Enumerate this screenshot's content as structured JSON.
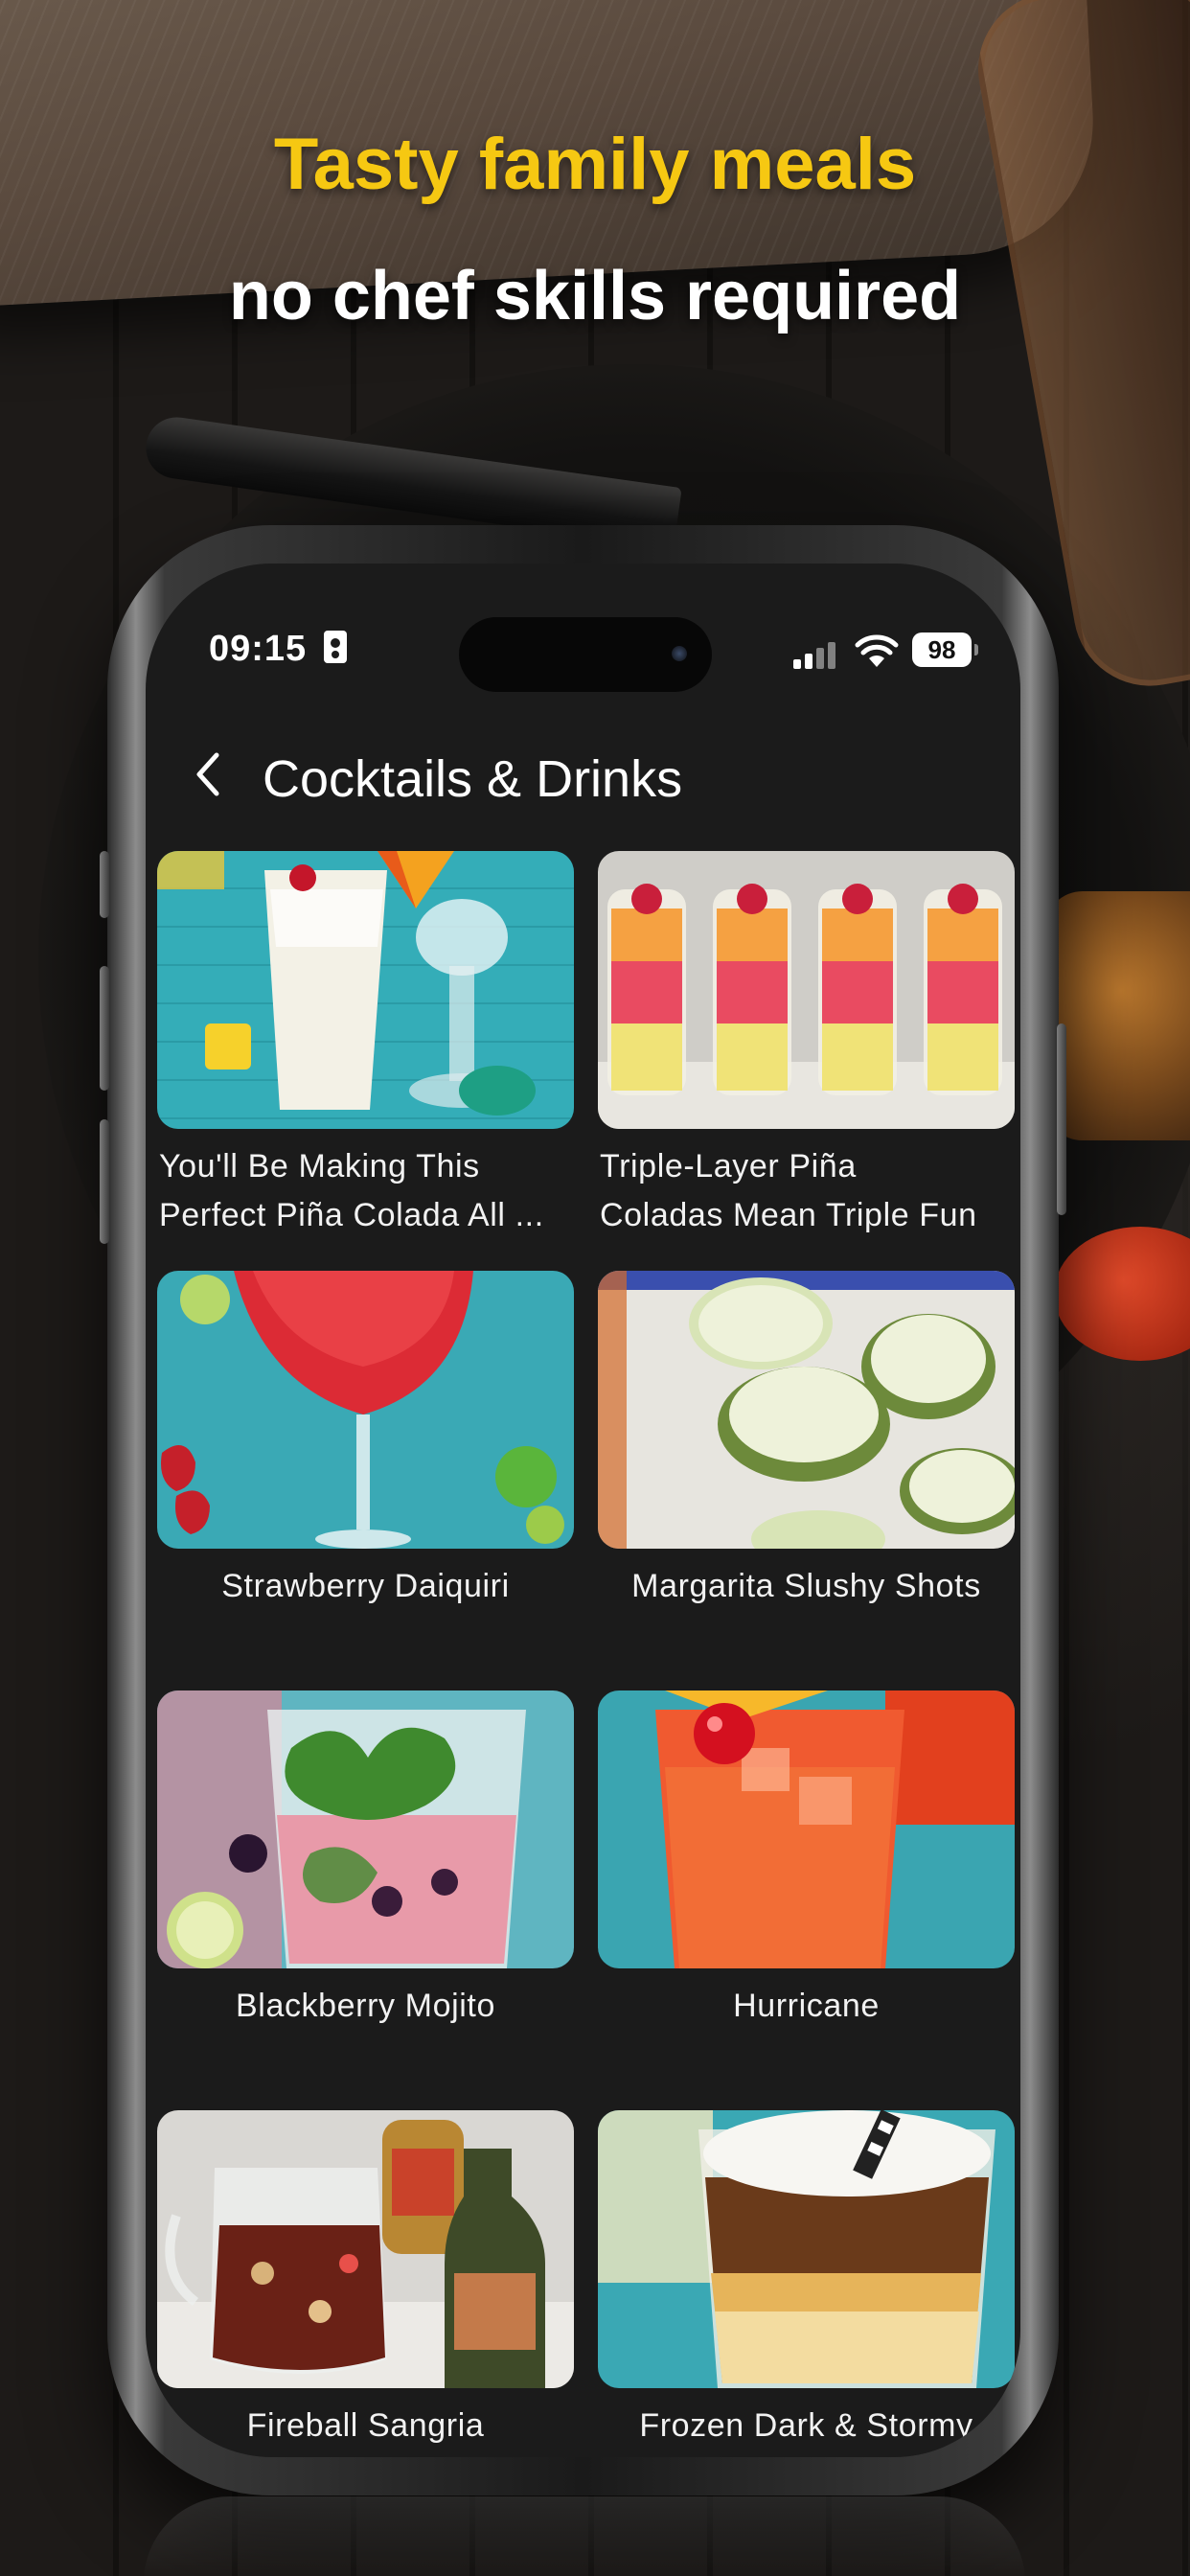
{
  "promo": {
    "headline": "Tasty family meals",
    "subline": "no chef skills required",
    "headline_color": "#f6c812"
  },
  "status_bar": {
    "time": "09:15",
    "battery": "98"
  },
  "header": {
    "back_icon": "chevron-left-icon",
    "title": "Cocktails & Drinks"
  },
  "recipes": [
    {
      "line1": "You'll Be Making This",
      "line2": "Perfect Piña Colada All ...",
      "image": "pina-colada-image"
    },
    {
      "line1": "Triple-Layer Piña",
      "line2": "Coladas Mean Triple Fun",
      "image": "layered-pina-colada-image"
    },
    {
      "title": "Strawberry Daiquiri",
      "image": "strawberry-daiquiri-image"
    },
    {
      "title": "Margarita Slushy Shots",
      "image": "margarita-shots-image"
    },
    {
      "title": "Blackberry Mojito",
      "image": "blackberry-mojito-image"
    },
    {
      "title": "Hurricane",
      "image": "hurricane-image"
    },
    {
      "title": "Fireball Sangria",
      "image": "fireball-sangria-image"
    },
    {
      "title": "Frozen Dark & Stormy",
      "image": "dark-stormy-image"
    }
  ]
}
